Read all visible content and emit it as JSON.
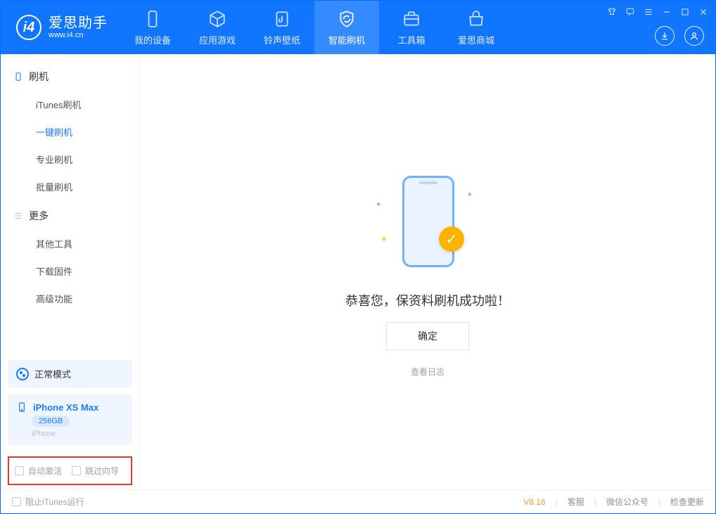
{
  "app": {
    "title": "爱思助手",
    "subtitle": "www.i4.cn"
  },
  "tabs": {
    "device": "我的设备",
    "apps": "应用游戏",
    "ring": "铃声壁纸",
    "flash": "智能刷机",
    "tools": "工具箱",
    "store": "爱思商城"
  },
  "sidebar": {
    "group_flash": "刷机",
    "items_flash": {
      "itunes": "iTunes刷机",
      "oneclick": "一键刷机",
      "pro": "专业刷机",
      "batch": "批量刷机"
    },
    "group_more": "更多",
    "items_more": {
      "other": "其他工具",
      "firmware": "下载固件",
      "advanced": "高级功能"
    },
    "mode": "正常模式",
    "device_name": "iPhone XS Max",
    "device_storage": "256GB",
    "device_type": "iPhone",
    "auto_activate": "自动激活",
    "skip_guide": "跳过向导"
  },
  "main": {
    "success": "恭喜您，保资料刷机成功啦！",
    "ok": "确定",
    "view_log": "查看日志"
  },
  "status": {
    "block_itunes": "阻止iTunes运行",
    "version": "V8.16",
    "cs": "客服",
    "wechat": "微信公众号",
    "update": "检查更新"
  }
}
